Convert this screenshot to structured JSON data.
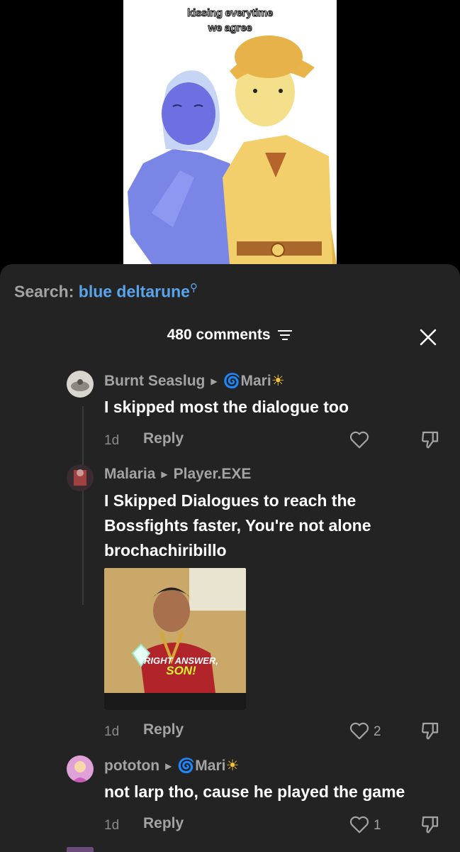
{
  "video": {
    "caption_line1": "kissing everytime",
    "caption_line2": "we agree"
  },
  "search": {
    "prefix": "Search:",
    "term": "blue deltarune"
  },
  "comments_header": {
    "count_label": "480 comments"
  },
  "comments": [
    {
      "author": "Burnt Seaslug",
      "reply_to": "Mari",
      "text": "I skipped most the dialogue too",
      "time": "1d",
      "reply_label": "Reply",
      "likes": ""
    },
    {
      "author": "Malaria",
      "reply_to": "Player.EXE",
      "text": "I Skipped Dialogues to reach the Bossfights faster, You're not alone brochachiribillo",
      "time": "1d",
      "reply_label": "Reply",
      "likes": "2",
      "gif_text_line1": "RIGHT ANSWER,",
      "gif_text_line2": "SON!"
    },
    {
      "author": "pototon",
      "reply_to": "Mari",
      "text": "not larp tho, cause he played the game",
      "time": "1d",
      "reply_label": "Reply",
      "likes": "1"
    }
  ],
  "colors": {
    "sheet_bg": "#232323",
    "accent_blue": "#5aa4ec",
    "muted": "#a3a3a3"
  }
}
